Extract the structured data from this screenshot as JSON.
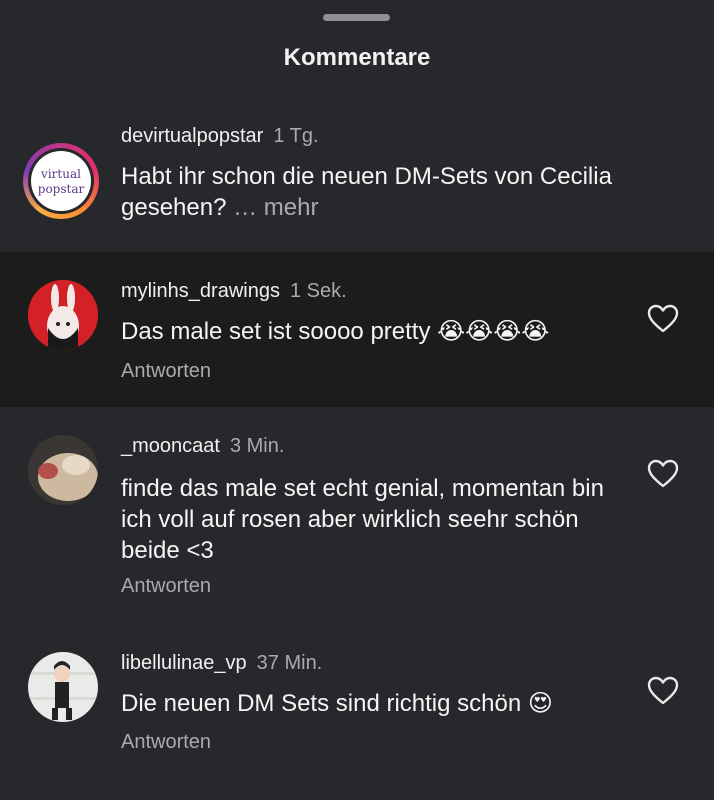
{
  "header": {
    "title": "Kommentare"
  },
  "caption": {
    "avatar_text_line1": "virtual",
    "avatar_text_line2": "popstar",
    "username": "devirtualpopstar",
    "time": "1 Tg.",
    "text": "Habt ihr schon die neuen DM-Sets von Cecilia gesehen?",
    "more": " … mehr"
  },
  "comments": [
    {
      "username": "mylinhs_drawings",
      "time": "1 Sek.",
      "text": "Das male set ist soooo pretty ",
      "emoji": "😭😭😭😭",
      "reply": "Antworten"
    },
    {
      "username": "_mooncaat",
      "time": "3 Min.",
      "text": "finde das male set echt genial, momentan bin ich voll auf rosen aber wirklich seehr schön beide <3",
      "emoji": "",
      "reply": "Antworten"
    },
    {
      "username": "libellulinae_vp",
      "time": "37 Min.",
      "text": "Die neuen DM Sets sind richtig schön ",
      "emoji": "😍",
      "reply": "Antworten"
    }
  ]
}
